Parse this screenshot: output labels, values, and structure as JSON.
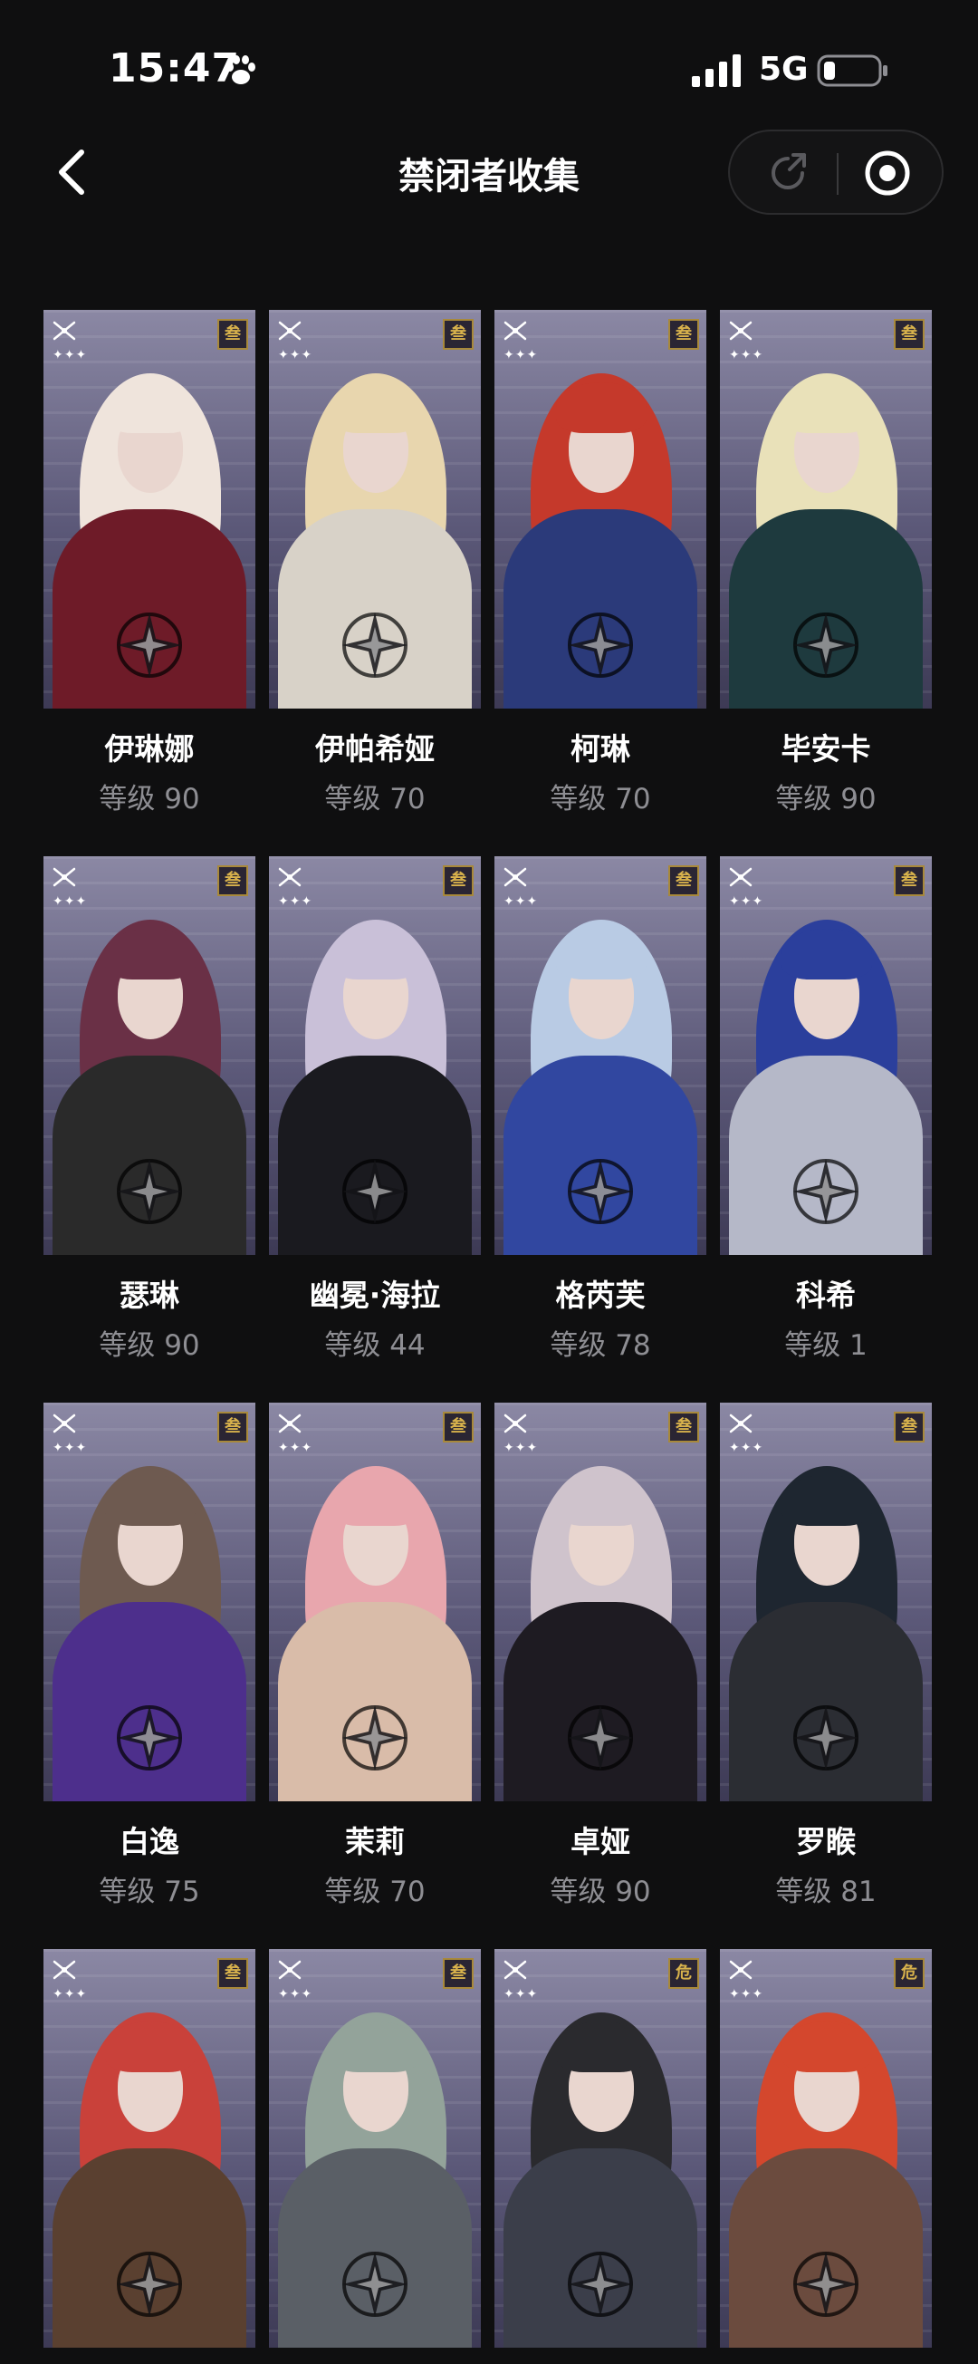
{
  "status_bar": {
    "time": "15:47",
    "network": "5G"
  },
  "nav": {
    "title": "禁闭者收集"
  },
  "characters": [
    {
      "name": "伊琳娜",
      "level": "等级 90",
      "hair": "#efe4dc",
      "accent": "#6e1b28",
      "rank": "叁"
    },
    {
      "name": "伊帕希娅",
      "level": "等级 70",
      "hair": "#e8d6ae",
      "accent": "#d8d2c8",
      "rank": "叁"
    },
    {
      "name": "柯琳",
      "level": "等级 70",
      "hair": "#c5392b",
      "accent": "#2b3a7a",
      "rank": "叁"
    },
    {
      "name": "毕安卡",
      "level": "等级 90",
      "hair": "#e9e1b9",
      "accent": "#1e3a3e",
      "rank": "叁"
    },
    {
      "name": "瑟琳",
      "level": "等级 90",
      "hair": "#6a3046",
      "accent": "#2a2a2a",
      "rank": "叁"
    },
    {
      "name": "幽冕·海拉",
      "level": "等级 44",
      "hair": "#c9c0d8",
      "accent": "#1a1a1f",
      "rank": "叁"
    },
    {
      "name": "格芮芙",
      "level": "等级 78",
      "hair": "#b9cbe4",
      "accent": "#3147a0",
      "rank": "叁"
    },
    {
      "name": "科希",
      "level": "等级 1",
      "hair": "#2b3f9c",
      "accent": "#b5b8c8",
      "rank": "叁"
    },
    {
      "name": "白逸",
      "level": "等级 75",
      "hair": "#6e5a50",
      "accent": "#4d2f8c",
      "rank": "叁"
    },
    {
      "name": "茉莉",
      "level": "等级 70",
      "hair": "#e8a6ad",
      "accent": "#d9bca9",
      "rank": "叁"
    },
    {
      "name": "卓娅",
      "level": "等级 90",
      "hair": "#cfc3cc",
      "accent": "#1e1b22",
      "rank": "叁"
    },
    {
      "name": "罗睺",
      "level": "等级 81",
      "hair": "#1e2630",
      "accent": "#2b2d33",
      "rank": "叁"
    },
    {
      "name": "",
      "level": "",
      "hair": "#c9413a",
      "accent": "#5a4030",
      "rank": "叁"
    },
    {
      "name": "",
      "level": "",
      "hair": "#93a39a",
      "accent": "#5a5f66",
      "rank": "叁"
    },
    {
      "name": "",
      "level": "",
      "hair": "#2a2a2e",
      "accent": "#3b3e4a",
      "rank": "危"
    },
    {
      "name": "",
      "level": "",
      "hair": "#d4472d",
      "accent": "#6b4b3e",
      "rank": "危"
    }
  ],
  "icons": {
    "back": "chevron-left-icon",
    "share": "share-icon",
    "record": "record-icon",
    "paw": "paw-icon"
  }
}
